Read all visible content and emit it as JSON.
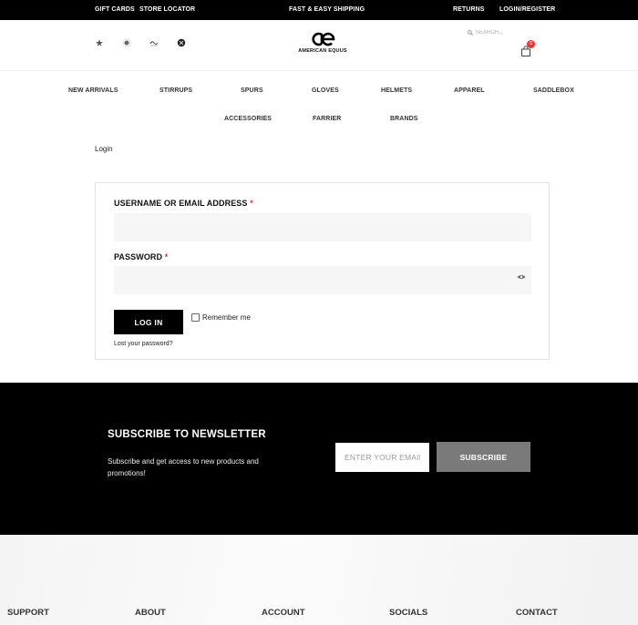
{
  "topbar": {
    "gift_cards": "GIFT CARDS",
    "store_locator": "STORE LOCATOR",
    "shipping": "FAST & EASY SHIPPING",
    "returns": "RETURNS",
    "login_register": "LOGIN/REGISTER"
  },
  "header": {
    "brand_icons": [
      "leaf-brand-icon",
      "sun-brand-icon",
      "script-brand-icon",
      "circle-brand-icon"
    ],
    "logo_text": "AMERICAN EQUUS",
    "search_placeholder": "SEARCH...",
    "cart_count": "0"
  },
  "nav": {
    "row1": [
      "NEW ARRIVALS",
      "STIRRUPS",
      "SPURS",
      "GLOVES",
      "HELMETS",
      "APPAREL",
      "SADDLEBOX"
    ],
    "row2": [
      "ACCESSORIES",
      "FARRIER",
      "BRANDS"
    ]
  },
  "breadcrumb": "Login",
  "login": {
    "username_label": "USERNAME OR EMAIL ADDRESS",
    "password_label": "PASSWORD",
    "required_mark": "*",
    "login_button": "LOG IN",
    "remember_me": "Remember me",
    "lost_password": "Lost your password?"
  },
  "newsletter": {
    "title": "SUBSCRIBE TO NEWSLETTER",
    "description": "Subscribe and get access to new products and promotions!",
    "email_placeholder": "ENTER YOUR EMAIL",
    "subscribe_button": "SUBSCRIBE"
  },
  "footer": {
    "columns": [
      "SUPPORT",
      "ABOUT",
      "ACCOUNT",
      "SOCIALS",
      "CONTACT"
    ]
  },
  "colors": {
    "topbar_bg": "#000000",
    "required": "#dd3333",
    "cart_badge": "#ee3333",
    "subscribe_bg": "#7a7a7a"
  }
}
